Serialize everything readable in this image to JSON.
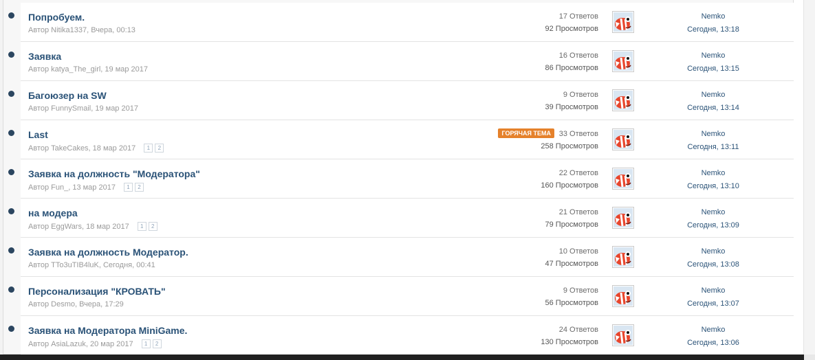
{
  "threads": [
    {
      "title": "Попробуем.",
      "author_line": "Автор Nitika1337, Вчера, 00:13",
      "pages": [],
      "hot": false,
      "replies": "17 Ответов",
      "views": "92 Просмотров",
      "last_user": "Nemko",
      "last_time": "Сегодня, 13:18"
    },
    {
      "title": "Заявка",
      "author_line": "Автор katya_The_girl, 19 мар 2017",
      "pages": [],
      "hot": false,
      "replies": "16 Ответов",
      "views": "86 Просмотров",
      "last_user": "Nemko",
      "last_time": "Сегодня, 13:15"
    },
    {
      "title": "Багоюзер на SW",
      "author_line": "Автор FunnySmail, 19 мар 2017",
      "pages": [],
      "hot": false,
      "replies": "9 Ответов",
      "views": "39 Просмотров",
      "last_user": "Nemko",
      "last_time": "Сегодня, 13:14"
    },
    {
      "title": "Last",
      "author_line": "Автор TakeCakes, 18 мар 2017",
      "pages": [
        "1",
        "2"
      ],
      "hot": true,
      "replies": "33 Ответов",
      "views": "258 Просмотров",
      "last_user": "Nemko",
      "last_time": "Сегодня, 13:11"
    },
    {
      "title": "Заявка на должность \"Модератора\"",
      "author_line": "Автор Fun_, 13 мар 2017",
      "pages": [
        "1",
        "2"
      ],
      "hot": false,
      "replies": "22 Ответов",
      "views": "160 Просмотров",
      "last_user": "Nemko",
      "last_time": "Сегодня, 13:10"
    },
    {
      "title": "на модера",
      "author_line": "Автор EggWars, 18 мар 2017",
      "pages": [
        "1",
        "2"
      ],
      "hot": false,
      "replies": "21 Ответов",
      "views": "79 Просмотров",
      "last_user": "Nemko",
      "last_time": "Сегодня, 13:09"
    },
    {
      "title": "Заявка на должность Модератор.",
      "author_line": "Автор TTo3uTIB4luK, Сегодня, 00:41",
      "pages": [],
      "hot": false,
      "replies": "10 Ответов",
      "views": "47 Просмотров",
      "last_user": "Nemko",
      "last_time": "Сегодня, 13:08"
    },
    {
      "title": "Персонализация \"КРОВАТЬ\"",
      "author_line": "Автор Desmo, Вчера, 17:29",
      "pages": [],
      "hot": false,
      "replies": "9 Ответов",
      "views": "56 Просмотров",
      "last_user": "Nemko",
      "last_time": "Сегодня, 13:07"
    },
    {
      "title": "Заявка на Модератора MiniGame.",
      "author_line": "Автор AsiaLazuk, 20 мар 2017",
      "pages": [
        "1",
        "2"
      ],
      "hot": false,
      "replies": "24 Ответов",
      "views": "130 Просмотров",
      "last_user": "Nemko",
      "last_time": "Сегодня, 13:06"
    }
  ],
  "hot_label": "ГОРЯЧАЯ ТЕМА",
  "avatar_icon": "fish-avatar-icon",
  "colors": {
    "title": "#2a5277",
    "hot": "#e5812b",
    "dot": "#2b4660"
  }
}
